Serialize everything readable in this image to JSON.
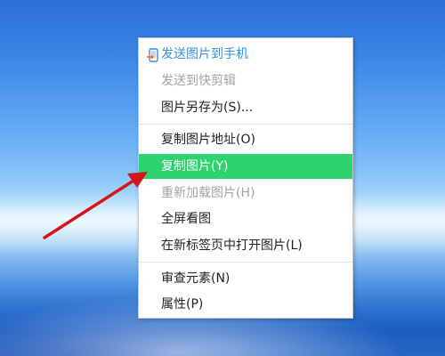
{
  "colors": {
    "highlight": "#2dd36f",
    "primary_text": "#3a8ee6",
    "disabled_text": "#a3a3a3",
    "arrow": "#d6141b"
  },
  "context_menu": {
    "items": [
      {
        "label": "发送图片到手机",
        "icon": "phone-send-icon",
        "style": "primary"
      },
      {
        "label": "发送到快剪辑",
        "style": "disabled"
      },
      {
        "label": "图片另存为(S)..."
      },
      {
        "label": "复制图片地址(O)"
      },
      {
        "label": "复制图片(Y)",
        "style": "highlighted"
      },
      {
        "label": "重新加载图片(H)",
        "style": "disabled"
      },
      {
        "label": "全屏看图"
      },
      {
        "label": "在新标签页中打开图片(L)"
      },
      {
        "label": "审查元素(N)"
      },
      {
        "label": "属性(P)"
      }
    ]
  }
}
